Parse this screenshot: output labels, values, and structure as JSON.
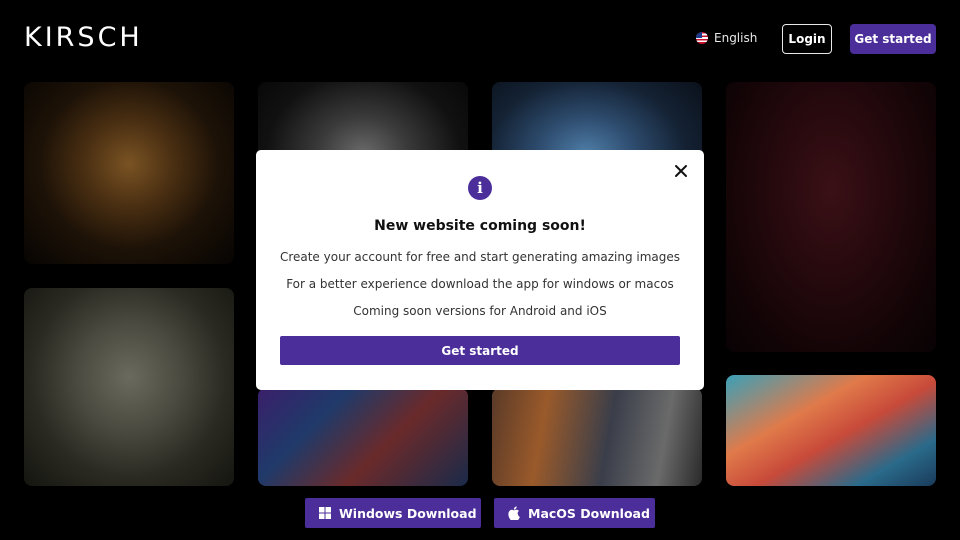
{
  "header": {
    "logo": "KIRSCH",
    "language": "English",
    "login_label": "Login",
    "cta_label": "Get started"
  },
  "modal": {
    "title": "New website coming soon!",
    "lines": [
      "Create your account for free and start generating amazing images",
      "For a better experience download the app for windows or macos",
      "Coming soon versions for Android and iOS"
    ],
    "cta_label": "Get started"
  },
  "downloads": {
    "windows_label": "Windows Download",
    "macos_label": "MacOS Download"
  },
  "colors": {
    "accent": "#4b2e9a",
    "background": "#000000",
    "modal_bg": "#ffffff"
  }
}
